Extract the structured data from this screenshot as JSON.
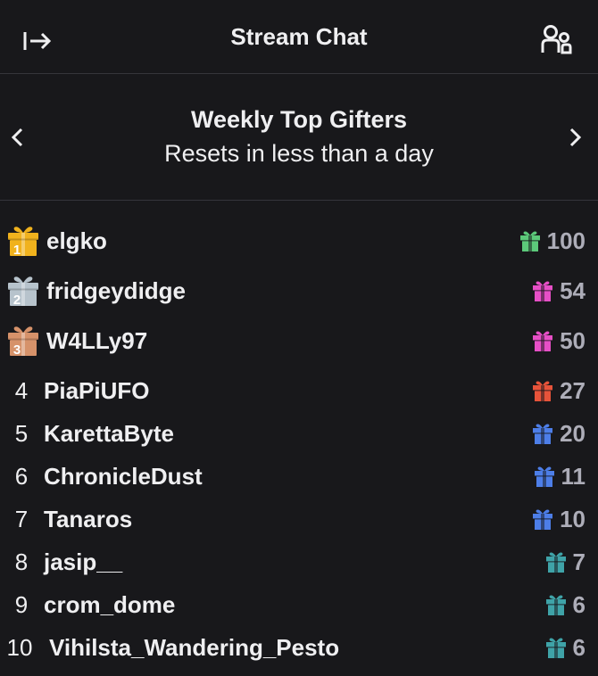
{
  "header": {
    "title": "Stream Chat",
    "collapse_icon": "collapse-right-icon",
    "users_icon": "community-users-icon"
  },
  "gifters": {
    "heading": "Weekly Top Gifters",
    "subheading": "Resets in less than a day"
  },
  "leaderboard": [
    {
      "rank": "1",
      "name": "elgko",
      "amount": "100",
      "gift_color": "#5cc97a",
      "medal_color": "#f0b21d"
    },
    {
      "rank": "2",
      "name": "fridgeydidge",
      "amount": "54",
      "gift_color": "#e64fc6",
      "medal_color": "#b7c3cc"
    },
    {
      "rank": "3",
      "name": "W4LLy97",
      "amount": "50",
      "gift_color": "#e64fc6",
      "medal_color": "#d6926a"
    },
    {
      "rank": "4",
      "name": "PiaPiUFO",
      "amount": "27",
      "gift_color": "#e7533a"
    },
    {
      "rank": "5",
      "name": "KarettaByte",
      "amount": "20",
      "gift_color": "#4d7ee8"
    },
    {
      "rank": "6",
      "name": "ChronicleDust",
      "amount": "11",
      "gift_color": "#4d7ee8"
    },
    {
      "rank": "7",
      "name": "Tanaros",
      "amount": "10",
      "gift_color": "#4d7ee8"
    },
    {
      "rank": "8",
      "name": "jasip__",
      "amount": "7",
      "gift_color": "#3fa3a8"
    },
    {
      "rank": "9",
      "name": "crom_dome",
      "amount": "6",
      "gift_color": "#3fa3a8"
    },
    {
      "rank": "10",
      "name": "Vihilsta_Wandering_Pesto",
      "amount": "6",
      "gift_color": "#3fa3a8"
    }
  ],
  "colors": {
    "background": "#18181b",
    "divider": "#35353b",
    "text": "#efeff1",
    "muted": "#adadb8"
  }
}
